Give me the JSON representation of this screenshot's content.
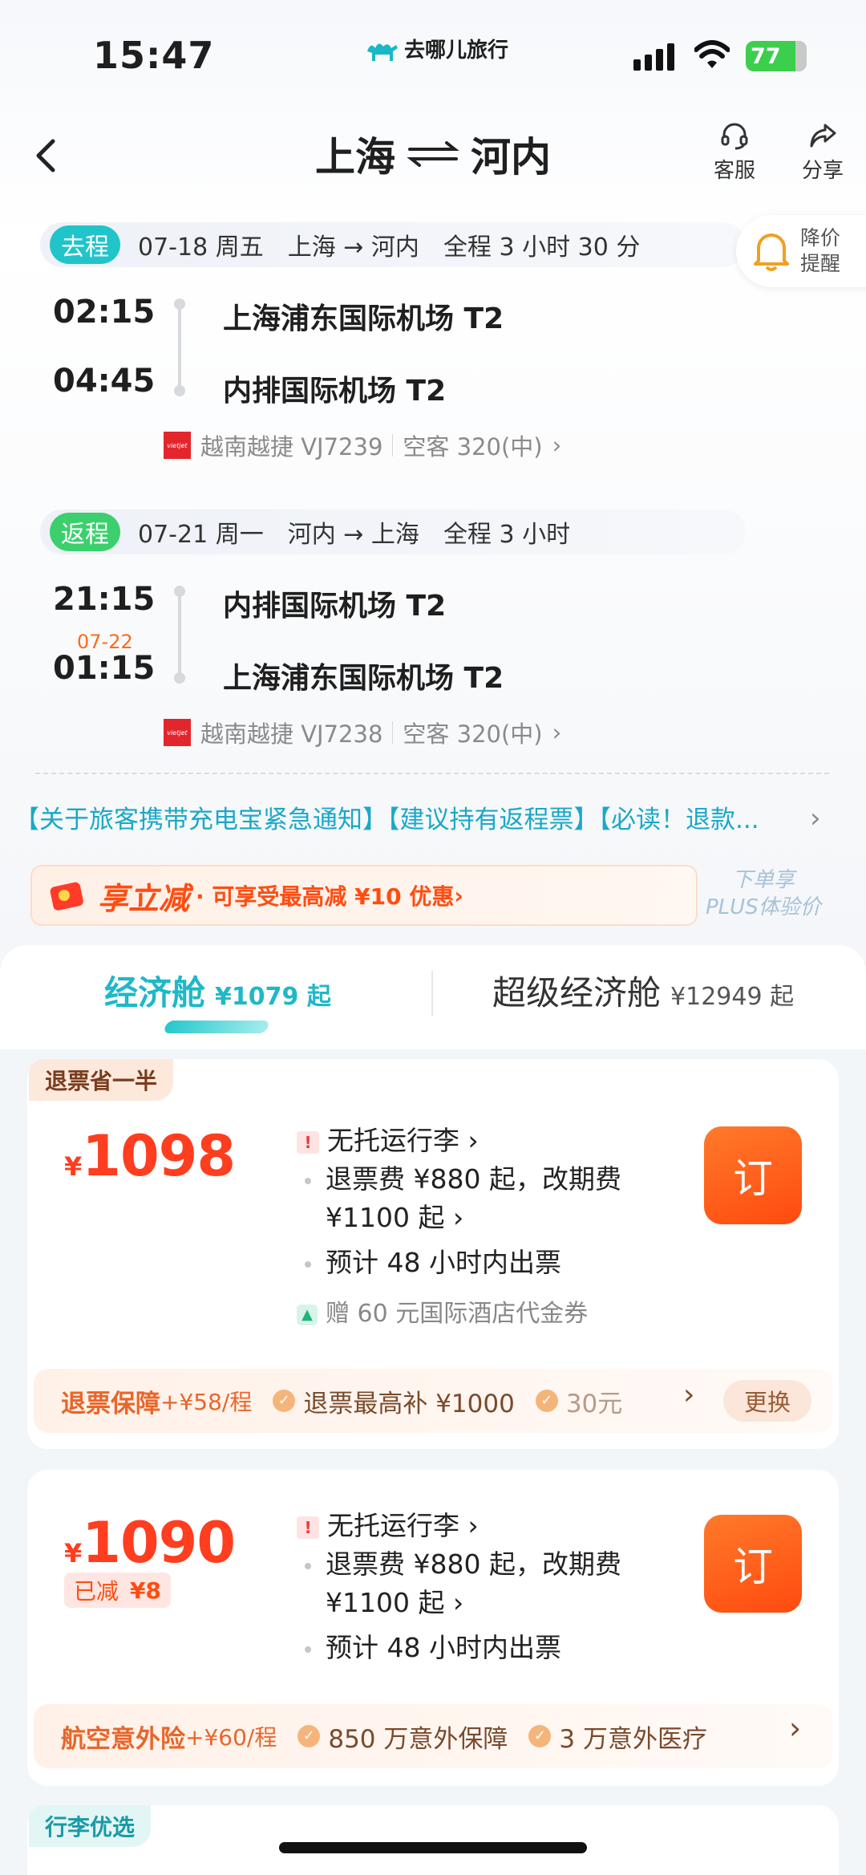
{
  "status_bar": {
    "time": "15:47",
    "app_brand": "去哪儿旅行",
    "battery": "77"
  },
  "header": {
    "origin": "上海",
    "destination": "河内",
    "service_label": "客服",
    "share_label": "分享"
  },
  "outbound": {
    "tag": "去程",
    "date": "07-18 周五",
    "route": "上海 → 河内",
    "duration": "全程 3 小时 30 分",
    "dep_time": "02:15",
    "arr_time": "04:45",
    "dep_airport": "上海浦东国际机场 T2",
    "arr_airport": "内排国际机场 T2",
    "airline": "越南越捷 VJ7239",
    "aircraft": "空客 320(中)"
  },
  "price_alert": {
    "line1": "降价",
    "line2": "提醒"
  },
  "return": {
    "tag": "返程",
    "date": "07-21 周一",
    "route": "河内 → 上海",
    "duration": "全程 3 小时",
    "dep_time": "21:15",
    "arr_time": "01:15",
    "arr_next_date": "07-22",
    "dep_airport": "内排国际机场 T2",
    "arr_airport": "上海浦东国际机场 T2",
    "airline": "越南越捷 VJ7238",
    "aircraft": "空客 320(中)"
  },
  "notice": "【关于旅客携带充电宝紧急通知】【建议持有返程票】【必读！退款...",
  "promo": {
    "title": "享立减",
    "detail": "· 可享受最高减 ¥10 优惠",
    "plus_line1": "下单享",
    "plus_line2": "PLUS体验价"
  },
  "cabin_tabs": [
    {
      "name": "经济舱",
      "price": "¥1079 起"
    },
    {
      "name": "超级经济舱",
      "price": "¥12949 起"
    }
  ],
  "offers": [
    {
      "ribbon": "退票省一半",
      "currency": "¥",
      "price": "1098",
      "baggage": "无托运行李 ›",
      "refund_line1": "退票费 ¥880 起，改期费",
      "refund_line2": "¥1100 起 ›",
      "ticketing": "预计 48 小时内出票",
      "gift": "赠 60 元国际酒店代金券",
      "book": "订",
      "addon_title": "退票保障",
      "addon_price": "+¥58/程",
      "addon_item1": "退票最高补 ¥1000",
      "addon_item2": "30元",
      "addon_change": "更换"
    },
    {
      "currency": "¥",
      "price": "1090",
      "reduced_label": "已减",
      "reduced_amount": "¥8",
      "baggage": "无托运行李 ›",
      "refund_line1": "退票费 ¥880 起，改期费",
      "refund_line2": "¥1100 起 ›",
      "ticketing": "预计 48 小时内出票",
      "book": "订",
      "addon_title": "航空意外险",
      "addon_price": "+¥60/程",
      "addon_item1": "850 万意外保障",
      "addon_item2": "3 万意外医疗"
    }
  ],
  "next_ribbon": "行李优选",
  "colors": {
    "accent": "#21c4c9",
    "price": "#ff3d1f",
    "book": "#ff5a18"
  }
}
